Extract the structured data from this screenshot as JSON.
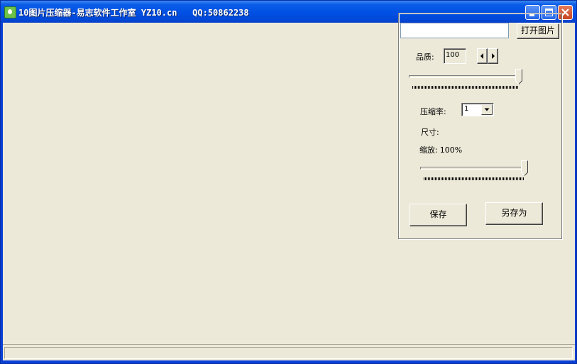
{
  "window": {
    "title": "10图片压缩器-易志软件工作室 YZ10.cn   QQ:50862238"
  },
  "panel": {
    "file_path": "",
    "open_button": "打开图片",
    "quality_label": "品质:",
    "quality_value": "100",
    "quality_level_percent": 100,
    "compress_label": "压缩率:",
    "compress_value": "1",
    "size_label": "尺寸:",
    "scale_label": "缩放:",
    "scale_value": "100%",
    "scale_level_percent": 100,
    "save_button": "保存",
    "save_as_button": "另存为"
  },
  "statusbar": {
    "text": ""
  }
}
